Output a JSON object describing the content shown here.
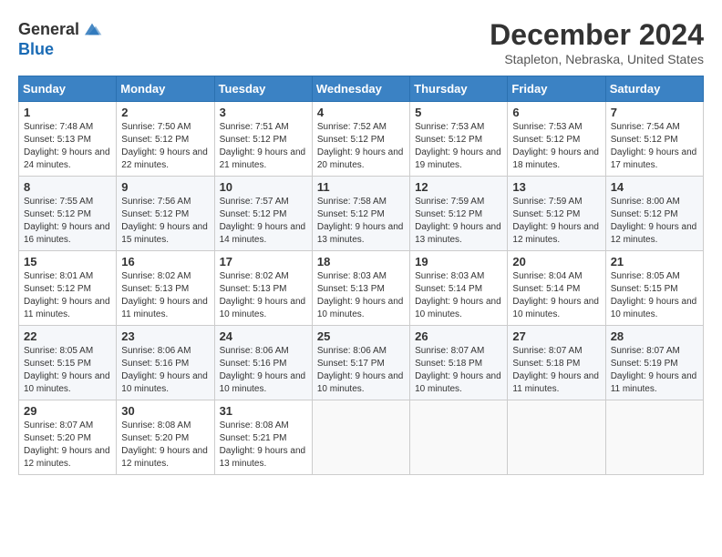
{
  "logo": {
    "general": "General",
    "blue": "Blue"
  },
  "title": {
    "month": "December 2024",
    "location": "Stapleton, Nebraska, United States"
  },
  "weekdays": [
    "Sunday",
    "Monday",
    "Tuesday",
    "Wednesday",
    "Thursday",
    "Friday",
    "Saturday"
  ],
  "weeks": [
    [
      {
        "day": "1",
        "sunrise": "7:48 AM",
        "sunset": "5:13 PM",
        "daylight": "9 hours and 24 minutes."
      },
      {
        "day": "2",
        "sunrise": "7:50 AM",
        "sunset": "5:12 PM",
        "daylight": "9 hours and 22 minutes."
      },
      {
        "day": "3",
        "sunrise": "7:51 AM",
        "sunset": "5:12 PM",
        "daylight": "9 hours and 21 minutes."
      },
      {
        "day": "4",
        "sunrise": "7:52 AM",
        "sunset": "5:12 PM",
        "daylight": "9 hours and 20 minutes."
      },
      {
        "day": "5",
        "sunrise": "7:53 AM",
        "sunset": "5:12 PM",
        "daylight": "9 hours and 19 minutes."
      },
      {
        "day": "6",
        "sunrise": "7:53 AM",
        "sunset": "5:12 PM",
        "daylight": "9 hours and 18 minutes."
      },
      {
        "day": "7",
        "sunrise": "7:54 AM",
        "sunset": "5:12 PM",
        "daylight": "9 hours and 17 minutes."
      }
    ],
    [
      {
        "day": "8",
        "sunrise": "7:55 AM",
        "sunset": "5:12 PM",
        "daylight": "9 hours and 16 minutes."
      },
      {
        "day": "9",
        "sunrise": "7:56 AM",
        "sunset": "5:12 PM",
        "daylight": "9 hours and 15 minutes."
      },
      {
        "day": "10",
        "sunrise": "7:57 AM",
        "sunset": "5:12 PM",
        "daylight": "9 hours and 14 minutes."
      },
      {
        "day": "11",
        "sunrise": "7:58 AM",
        "sunset": "5:12 PM",
        "daylight": "9 hours and 13 minutes."
      },
      {
        "day": "12",
        "sunrise": "7:59 AM",
        "sunset": "5:12 PM",
        "daylight": "9 hours and 13 minutes."
      },
      {
        "day": "13",
        "sunrise": "7:59 AM",
        "sunset": "5:12 PM",
        "daylight": "9 hours and 12 minutes."
      },
      {
        "day": "14",
        "sunrise": "8:00 AM",
        "sunset": "5:12 PM",
        "daylight": "9 hours and 12 minutes."
      }
    ],
    [
      {
        "day": "15",
        "sunrise": "8:01 AM",
        "sunset": "5:12 PM",
        "daylight": "9 hours and 11 minutes."
      },
      {
        "day": "16",
        "sunrise": "8:02 AM",
        "sunset": "5:13 PM",
        "daylight": "9 hours and 11 minutes."
      },
      {
        "day": "17",
        "sunrise": "8:02 AM",
        "sunset": "5:13 PM",
        "daylight": "9 hours and 10 minutes."
      },
      {
        "day": "18",
        "sunrise": "8:03 AM",
        "sunset": "5:13 PM",
        "daylight": "9 hours and 10 minutes."
      },
      {
        "day": "19",
        "sunrise": "8:03 AM",
        "sunset": "5:14 PM",
        "daylight": "9 hours and 10 minutes."
      },
      {
        "day": "20",
        "sunrise": "8:04 AM",
        "sunset": "5:14 PM",
        "daylight": "9 hours and 10 minutes."
      },
      {
        "day": "21",
        "sunrise": "8:05 AM",
        "sunset": "5:15 PM",
        "daylight": "9 hours and 10 minutes."
      }
    ],
    [
      {
        "day": "22",
        "sunrise": "8:05 AM",
        "sunset": "5:15 PM",
        "daylight": "9 hours and 10 minutes."
      },
      {
        "day": "23",
        "sunrise": "8:06 AM",
        "sunset": "5:16 PM",
        "daylight": "9 hours and 10 minutes."
      },
      {
        "day": "24",
        "sunrise": "8:06 AM",
        "sunset": "5:16 PM",
        "daylight": "9 hours and 10 minutes."
      },
      {
        "day": "25",
        "sunrise": "8:06 AM",
        "sunset": "5:17 PM",
        "daylight": "9 hours and 10 minutes."
      },
      {
        "day": "26",
        "sunrise": "8:07 AM",
        "sunset": "5:18 PM",
        "daylight": "9 hours and 10 minutes."
      },
      {
        "day": "27",
        "sunrise": "8:07 AM",
        "sunset": "5:18 PM",
        "daylight": "9 hours and 11 minutes."
      },
      {
        "day": "28",
        "sunrise": "8:07 AM",
        "sunset": "5:19 PM",
        "daylight": "9 hours and 11 minutes."
      }
    ],
    [
      {
        "day": "29",
        "sunrise": "8:07 AM",
        "sunset": "5:20 PM",
        "daylight": "9 hours and 12 minutes."
      },
      {
        "day": "30",
        "sunrise": "8:08 AM",
        "sunset": "5:20 PM",
        "daylight": "9 hours and 12 minutes."
      },
      {
        "day": "31",
        "sunrise": "8:08 AM",
        "sunset": "5:21 PM",
        "daylight": "9 hours and 13 minutes."
      },
      null,
      null,
      null,
      null
    ]
  ],
  "labels": {
    "sunrise": "Sunrise:",
    "sunset": "Sunset:",
    "daylight": "Daylight:"
  }
}
